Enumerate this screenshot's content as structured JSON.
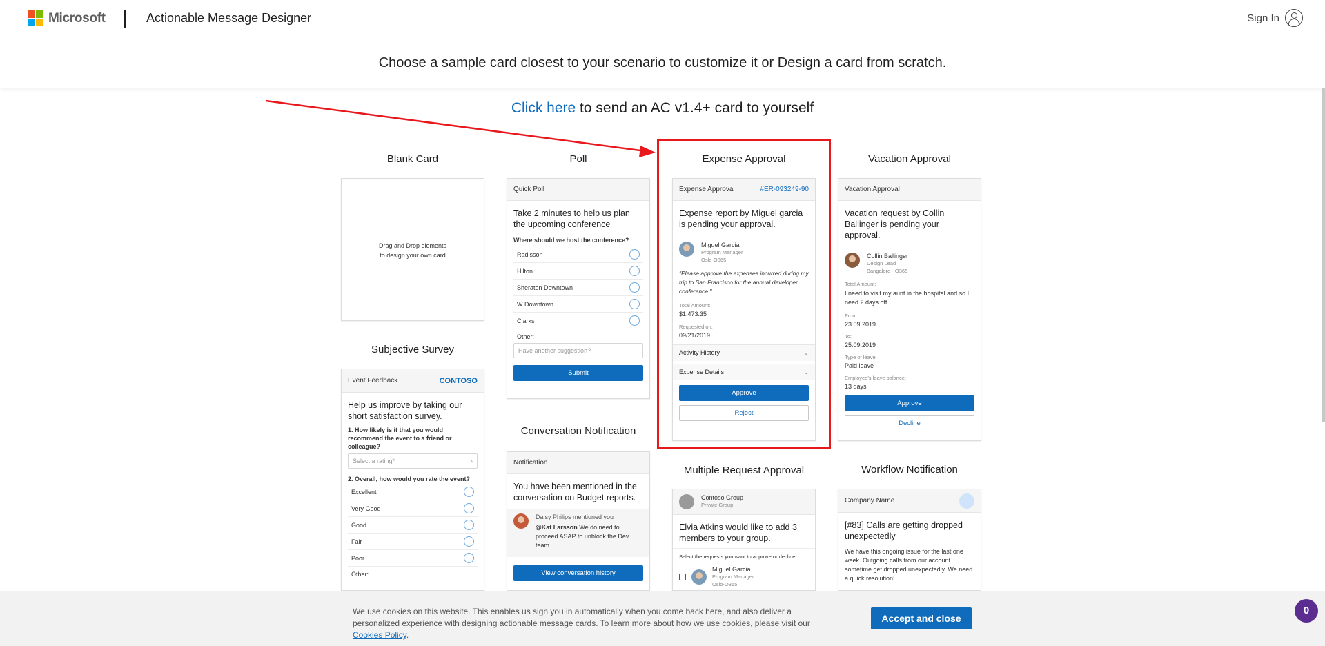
{
  "header": {
    "brand": "Microsoft",
    "app_title": "Actionable Message Designer",
    "sign_in": "Sign In"
  },
  "subheader": {
    "title": "Choose a sample card closest to your scenario to customize it or Design a card from scratch."
  },
  "send_line": {
    "link": "Click here",
    "rest": " to send an AC v1.4+ card to yourself"
  },
  "colors": {
    "accent": "#0f6cbd",
    "highlight": "#e8181c",
    "logo_red": "#f25022",
    "logo_green": "#7fba00",
    "logo_blue": "#00a4ef",
    "logo_yellow": "#ffb900"
  },
  "blank": {
    "title": "Blank Card",
    "hint_line1": "Drag and Drop elements",
    "hint_line2": "to design your own card"
  },
  "poll": {
    "title": "Poll",
    "head": "Quick Poll",
    "heading": "Take 2 minutes to help us plan the upcoming conference",
    "question": "Where should we host the conference?",
    "options": [
      "Radisson",
      "Hilton",
      "Sheraton Downtown",
      "W Downtown",
      "Clarks"
    ],
    "other_label": "Other:",
    "placeholder": "Have another suggestion?",
    "submit": "Submit"
  },
  "expense": {
    "title": "Expense Approval",
    "head": "Expense Approval",
    "ref": "#ER-093249-90",
    "heading": "Expense report by Miguel garcia is pending your approval.",
    "person_name": "Miguel Garcia",
    "person_role": "Program Manager",
    "person_loc": "Oslo-O365",
    "quote": "\"Please approve the expenses incurred during my trip to San Francisco for the annual developer conference.\"",
    "total_label": "Total Amount:",
    "total": "$1,473.35",
    "requested_label": "Requested on:",
    "requested": "09/21/2019",
    "activity": "Activity History",
    "details": "Expense Details",
    "approve": "Approve",
    "reject": "Reject"
  },
  "vacation": {
    "title": "Vacation Approval",
    "head": "Vacation Approval",
    "heading": "Vacation request by Collin Ballinger is pending your approval.",
    "person_name": "Collin Ballinger",
    "person_role": "Design Lead",
    "person_loc": "Bangalore - O365",
    "total_label": "Total Amount:",
    "reason": "I need to visit my aunt in the hospital and so I need 2 days off.",
    "from_label": "From:",
    "from": "23.09.2019",
    "to_label": "To:",
    "to": "25.09.2019",
    "type_label": "Type of leave:",
    "type": "Paid leave",
    "balance_label": "Employee's leave balance:",
    "balance": "13 days",
    "approve": "Approve",
    "decline": "Decline"
  },
  "survey": {
    "title": "Subjective Survey",
    "head": "Event Feedback",
    "brand": "CONTOSO",
    "heading": "Help us improve by taking our short satisfaction survey.",
    "q1": "1. How likely is it that you would recommend the event to a friend or colleague?",
    "q1_placeholder": "Select a rating*",
    "q2": "2. Overall, how would you rate the event?",
    "options": [
      "Excellent",
      "Very Good",
      "Good",
      "Fair",
      "Poor"
    ],
    "other_label": "Other:"
  },
  "conversation": {
    "title": "Conversation Notification",
    "head": "Notification",
    "heading": "You have been mentioned in the conversation on Budget reports.",
    "mention": "Daisy Philips mentioned you",
    "mention_user": "@Kat Larsson",
    "message": " We do need to proceed ASAP to unblock the Dev team.",
    "button": "View conversation history"
  },
  "multi": {
    "title": "Multiple Request Approval",
    "group": "Contoso Group",
    "group_sub": "Private Group",
    "heading": "Elvia Atkins would like to add 3 members to your group.",
    "instruction": "Select the requests you want to approve or decline.",
    "person_name": "Miguel Garcia",
    "person_role": "Program Manager",
    "person_loc": "Oslo-O365"
  },
  "workflow": {
    "title": "Workflow Notification",
    "head": "Company Name",
    "heading": "[#83] Calls are getting dropped unexpectedly",
    "body": "We have this ongoing issue for the last one week. Outgoing calls from our account sometime get dropped unexpectedly. We need a quick resolution!"
  },
  "cookie": {
    "text": "We use cookies on this website. This enables us sign you in automatically when you come back here, and also deliver a personalized experience with designing actionable message cards. To learn more about how we use cookies, please visit our ",
    "link": "Cookies Policy",
    "end": ".",
    "button": "Accept and close"
  },
  "chat_badge": "0"
}
